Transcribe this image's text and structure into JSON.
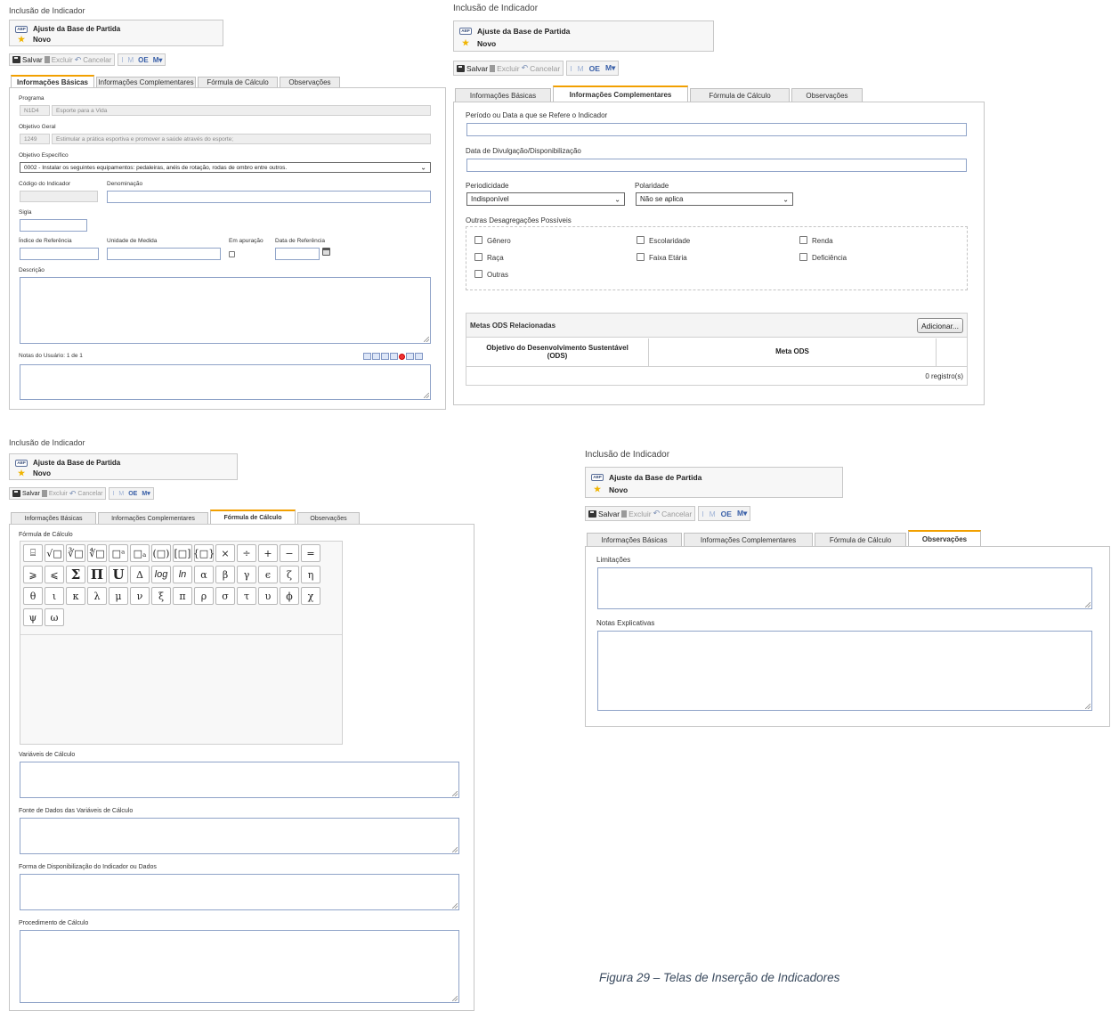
{
  "page": {
    "title": "Inclusão de Indicador",
    "record_name": "Ajuste da Base de Partida",
    "record_status": "Novo",
    "record_icon_text": "ABP"
  },
  "toolbar": {
    "save": "Salvar",
    "delete": "Excluir",
    "cancel": "Cancelar",
    "tool_i": "I",
    "tool_m": "M",
    "tool_oe": "OE",
    "tool_mp": "M"
  },
  "tabs": [
    "Informações Básicas",
    "Informações Complementares",
    "Fórmula de Cálculo",
    "Observações"
  ],
  "basic": {
    "programa_label": "Programa",
    "programa_code": "N1D4",
    "programa_value": "Esporte para a Vida",
    "objetivo_geral_label": "Objetivo Geral",
    "objetivo_geral_code": "1249",
    "objetivo_geral_value": "Estimular a prática esportiva e promover a saúde através do esporte;",
    "objetivo_especifico_label": "Objetivo Específico",
    "objetivo_especifico_value": "0002 - Instalar os seguintes equipamentos: pedaleiras, anéis de rotação, rodas de ombro entre outros.",
    "codigo_label": "Código do Indicador",
    "denominacao_label": "Denominação",
    "sigla_label": "Sigla",
    "indice_label": "Índice de Referência",
    "unidade_label": "Unidade de Medida",
    "apuracao_label": "Em apuração",
    "data_ref_label": "Data de Referência",
    "descricao_label": "Descrição",
    "notas_label": "Notas do Usuário: 1 de 1"
  },
  "complementares": {
    "periodo_label": "Período ou Data a que se Refere o Indicador",
    "divulgacao_label": "Data de Divulgação/Disponibilização",
    "periodicidade_label": "Periodicidade",
    "periodicidade_value": "Indisponível",
    "polaridade_label": "Polaridade",
    "polaridade_value": "Não se aplica",
    "desagregacoes_label": "Outras Desagregações Possíveis",
    "checkboxes": [
      "Gênero",
      "Escolaridade",
      "Renda",
      "Raça",
      "Faixa Etária",
      "Deficiência",
      "Outras"
    ],
    "ods_title": "Metas ODS Relacionadas",
    "ods_add": "Adicionar...",
    "ods_col1": "Objetivo do Desenvolvimento Sustentável (ODS)",
    "ods_col2": "Meta ODS",
    "ods_count": "0 registro(s)"
  },
  "formula": {
    "formula_label": "Fórmula de Cálculo",
    "symbols_row1": [
      "⌸",
      "√□",
      "∛□",
      "∜□",
      "□ᵃ",
      "□ₐ",
      "(□)",
      "[□]",
      "{□}",
      "×",
      "÷",
      "+",
      "−",
      "="
    ],
    "symbols_row2": [
      "⩾",
      "⩽",
      "Σ",
      "Π",
      "U",
      "Δ",
      "log",
      "ln",
      "α",
      "β",
      "γ",
      "ϵ",
      "ζ",
      "η"
    ],
    "symbols_row3": [
      "θ",
      "ι",
      "κ",
      "λ",
      "μ",
      "ν",
      "ξ",
      "π",
      "ρ",
      "σ",
      "τ",
      "υ",
      "ϕ",
      "χ"
    ],
    "symbols_row4": [
      "ψ",
      "ω"
    ],
    "variaveis_label": "Variáveis de Cálculo",
    "fonte_label": "Fonte de Dados das Variáveis de Cálculo",
    "forma_label": "Forma de Disponibilização do Indicador ou Dados",
    "procedimento_label": "Procedimento de Cálculo"
  },
  "observacoes": {
    "limitacoes_label": "Limitações",
    "notas_label": "Notas Explicativas"
  },
  "caption": "Figura 29 – Telas de Inserção de Indicadores",
  "colors": {
    "tab_accent": "#f2a000",
    "input_border": "#8fa3c8",
    "star": "#f0b400"
  }
}
